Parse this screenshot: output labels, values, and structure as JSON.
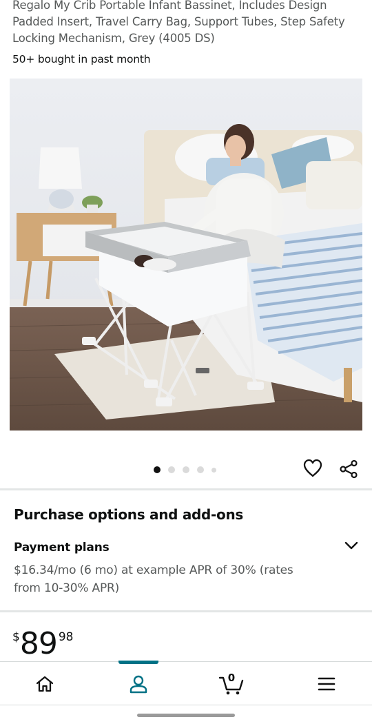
{
  "product": {
    "title": "Regalo My Crib Portable Infant Bassinet, Includes Design Padded Insert, Travel Carry Bag, Support Tubes, Step Safety Locking Mechanism, Grey (4005 DS)",
    "bought_text": "50+ bought in past month"
  },
  "gallery": {
    "image_count": 5,
    "active_index": 0,
    "wishlist_icon": "heart-outline-icon",
    "share_icon": "share-icon"
  },
  "purchase_options": {
    "title": "Purchase options and add-ons",
    "payment_plans": {
      "label": "Payment plans",
      "description": "$16.34/mo (6 mo) at example APR of 30% (rates from 10-30% APR)"
    }
  },
  "price": {
    "symbol": "$",
    "whole": "89",
    "fraction": "98"
  },
  "bottom_nav": {
    "items": [
      {
        "name": "home",
        "icon": "home-icon"
      },
      {
        "name": "account",
        "icon": "person-icon",
        "active": true
      },
      {
        "name": "cart",
        "icon": "cart-icon",
        "count": "0"
      },
      {
        "name": "menu",
        "icon": "hamburger-menu-icon"
      }
    ]
  },
  "colors": {
    "accent": "#007185",
    "text_primary": "#0f1111",
    "text_secondary": "#565959"
  }
}
